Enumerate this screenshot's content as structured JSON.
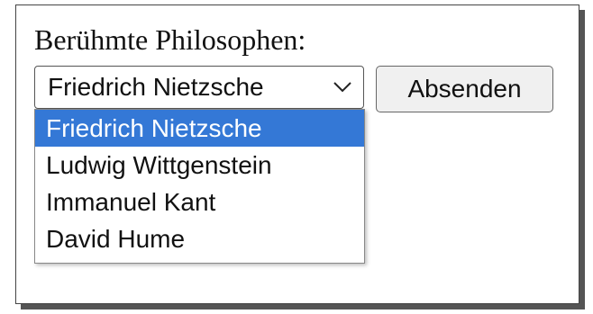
{
  "form": {
    "label": "Berühmte Philosophen:",
    "select": {
      "value": "Friedrich Nietzsche",
      "options": [
        "Friedrich Nietzsche",
        "Ludwig Wittgenstein",
        "Immanuel Kant",
        "David Hume"
      ]
    },
    "submit_label": "Absenden"
  },
  "colors": {
    "highlight": "#3478d6"
  }
}
